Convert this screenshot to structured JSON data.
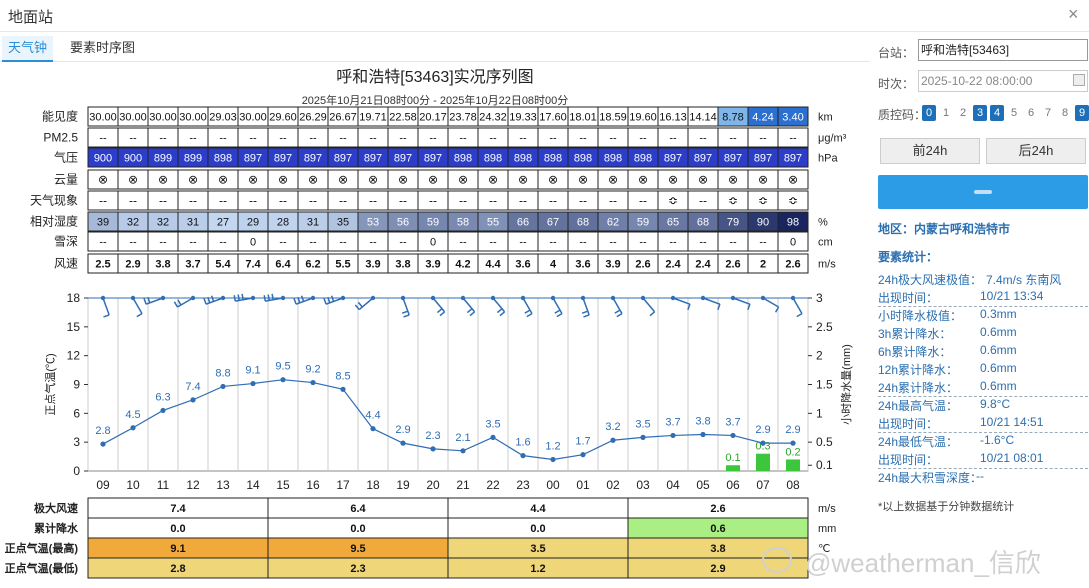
{
  "window": {
    "title": "地面站",
    "close": "×"
  },
  "tabs": [
    {
      "label": "天气钟",
      "active": true
    },
    {
      "label": "要素时序图",
      "active": false
    }
  ],
  "chart": {
    "title": "呼和浩特[53463]实况序列图",
    "subtitle": "2025年10月21日08时00分 - 2025年10月22日08时00分",
    "hours": [
      "09",
      "10",
      "11",
      "12",
      "13",
      "14",
      "15",
      "16",
      "17",
      "18",
      "19",
      "20",
      "21",
      "22",
      "23",
      "00",
      "01",
      "02",
      "03",
      "04",
      "05",
      "06",
      "07",
      "08"
    ],
    "rows": [
      {
        "label": "能见度",
        "unit": "km",
        "values": [
          "30.00",
          "30.00",
          "30.00",
          "30.00",
          "29.03",
          "30.00",
          "29.60",
          "26.29",
          "26.67",
          "19.71",
          "22.58",
          "20.17",
          "23.78",
          "24.32",
          "19.33",
          "17.60",
          "18.01",
          "18.59",
          "19.60",
          "16.13",
          "14.14",
          "8.78",
          "4.24",
          "3.40"
        ]
      },
      {
        "label": "PM2.5",
        "unit": "μg/m³",
        "values": [
          "--",
          "--",
          "--",
          "--",
          "--",
          "--",
          "--",
          "--",
          "--",
          "--",
          "--",
          "--",
          "--",
          "--",
          "--",
          "--",
          "--",
          "--",
          "--",
          "--",
          "--",
          "--",
          "--",
          "--"
        ]
      },
      {
        "label": "气压",
        "unit": "hPa",
        "values": [
          "900",
          "900",
          "899",
          "899",
          "898",
          "897",
          "897",
          "897",
          "897",
          "897",
          "897",
          "897",
          "898",
          "898",
          "898",
          "898",
          "898",
          "898",
          "898",
          "897",
          "897",
          "897",
          "897",
          "897"
        ]
      },
      {
        "label": "云量",
        "unit": "",
        "values": [
          "⊗",
          "⊗",
          "⊗",
          "⊗",
          "⊗",
          "⊗",
          "⊗",
          "⊗",
          "⊗",
          "⊗",
          "⊗",
          "⊗",
          "⊗",
          "⊗",
          "⊗",
          "⊗",
          "⊗",
          "⊗",
          "⊗",
          "⊗",
          "⊗",
          "⊗",
          "⊗",
          "⊗"
        ]
      },
      {
        "label": "天气现象",
        "unit": "",
        "values": [
          "--",
          "--",
          "--",
          "--",
          "--",
          "--",
          "--",
          "--",
          "--",
          "--",
          "--",
          "--",
          "--",
          "--",
          "--",
          "--",
          "--",
          "--",
          "--",
          "≎",
          "--",
          "≎",
          "≎",
          "≎"
        ]
      },
      {
        "label": "相对湿度",
        "unit": "%",
        "values": [
          "39",
          "32",
          "32",
          "31",
          "27",
          "29",
          "28",
          "31",
          "35",
          "53",
          "56",
          "59",
          "58",
          "55",
          "66",
          "67",
          "68",
          "62",
          "59",
          "65",
          "68",
          "79",
          "90",
          "98"
        ]
      },
      {
        "label": "雪深",
        "unit": "cm",
        "values": [
          "--",
          "--",
          "--",
          "--",
          "--",
          "0",
          "--",
          "--",
          "--",
          "--",
          "--",
          "0",
          "--",
          "--",
          "--",
          "--",
          "--",
          "--",
          "--",
          "--",
          "--",
          "--",
          "--",
          "0"
        ]
      },
      {
        "label": "风速",
        "unit": "m/s",
        "values": [
          "2.5",
          "2.9",
          "3.8",
          "3.7",
          "5.4",
          "7.4",
          "6.4",
          "6.2",
          "5.5",
          "3.9",
          "3.8",
          "3.9",
          "4.2",
          "4.4",
          "3.6",
          "4",
          "3.6",
          "3.9",
          "2.6",
          "2.4",
          "2.4",
          "2.6",
          "2",
          "2.6"
        ]
      }
    ],
    "colors": {
      "vis_high": "#ffffff",
      "vis_mid": "#7fb6ea",
      "vis_low": "#2b6fd0",
      "pressure": "#2c3ec9",
      "humidity_low": "#c8dcf5",
      "humidity_high": "#14205a",
      "line": "#2f6db5",
      "bar": "#3cc63c",
      "gust_bg": "#ffffff",
      "temp_high_a": "#f2a93b",
      "temp_low": "#efd679",
      "rain_bg": "#a9ef84"
    },
    "y_left_label": "正点气温(℃)",
    "y_right_label": "小时降水量(mm)",
    "y_left_ticks": [
      "0",
      "3",
      "6",
      "9",
      "12",
      "15",
      "18"
    ],
    "y_right_ticks": [
      "0.1",
      "0.5",
      "1",
      "1.5",
      "2",
      "2.5",
      "3"
    ],
    "summary": [
      {
        "label": "极大风速",
        "unit": "m/s",
        "values": [
          "7.4",
          "6.4",
          "4.4",
          "2.6"
        ]
      },
      {
        "label": "累计降水",
        "unit": "mm",
        "values": [
          "0.0",
          "0.0",
          "0.0",
          "0.6"
        ]
      },
      {
        "label": "正点气温(最高)",
        "unit": "℃",
        "values": [
          "9.1",
          "9.5",
          "3.5",
          "3.8"
        ]
      },
      {
        "label": "正点气温(最低)",
        "unit": "",
        "values": [
          "2.8",
          "2.3",
          "1.2",
          "2.9"
        ]
      }
    ]
  },
  "chart_data": {
    "type": "line",
    "x": [
      "09",
      "10",
      "11",
      "12",
      "13",
      "14",
      "15",
      "16",
      "17",
      "18",
      "19",
      "20",
      "21",
      "22",
      "23",
      "00",
      "01",
      "02",
      "03",
      "04",
      "05",
      "06",
      "07",
      "08"
    ],
    "series": [
      {
        "name": "正点气温(℃)",
        "values": [
          2.8,
          4.5,
          6.3,
          7.4,
          8.8,
          9.1,
          9.5,
          9.2,
          8.5,
          4.4,
          2.9,
          2.3,
          2.1,
          3.5,
          1.6,
          1.2,
          1.7,
          3.2,
          3.5,
          3.7,
          3.8,
          3.7,
          2.9,
          2.9
        ]
      },
      {
        "name": "小时降水量(mm)",
        "type": "bar",
        "values": [
          0,
          0,
          0,
          0,
          0,
          0,
          0,
          0,
          0,
          0,
          0,
          0,
          0,
          0,
          0,
          0,
          0,
          0,
          0,
          0,
          0,
          0.1,
          0.3,
          0.2
        ]
      }
    ],
    "ylim_left": [
      0,
      18
    ],
    "ylim_right": [
      0,
      3
    ]
  },
  "sidebar": {
    "station_label": "台站：",
    "station_value": "呼和浩特[53463]",
    "time_label": "时次：",
    "time_value": "2025-10-22 08:00:00",
    "qc_label": "质控码：",
    "qc_codes": [
      {
        "v": "0",
        "on": true
      },
      {
        "v": "1",
        "on": false
      },
      {
        "v": "2",
        "on": false
      },
      {
        "v": "3",
        "on": true
      },
      {
        "v": "4",
        "on": true
      },
      {
        "v": "5",
        "on": false
      },
      {
        "v": "6",
        "on": false
      },
      {
        "v": "7",
        "on": false
      },
      {
        "v": "8",
        "on": false
      },
      {
        "v": "9",
        "on": true
      }
    ],
    "prev": "前24h",
    "next": "后24h",
    "region": "地区：内蒙古呼和浩特市",
    "stats_title": "要素统计：",
    "stats": [
      {
        "k": "24h极大风速极值：",
        "v": "7.4m/s 东南风"
      },
      {
        "k": "出现时间：",
        "v": "10/21 13:34"
      },
      {
        "k": "小时降水极值：",
        "v": "0.3mm"
      },
      {
        "k": "3h累计降水：",
        "v": "0.6mm"
      },
      {
        "k": "6h累计降水：",
        "v": "0.6mm"
      },
      {
        "k": "12h累计降水：",
        "v": "0.6mm"
      },
      {
        "k": "24h累计降水：",
        "v": "0.6mm"
      },
      {
        "k": "24h最高气温：",
        "v": "9.8°C"
      },
      {
        "k": "出现时间：",
        "v": "10/21 14:51"
      },
      {
        "k": "24h最低气温：",
        "v": "-1.6°C"
      },
      {
        "k": "出现时间：",
        "v": "10/21 08:01"
      },
      {
        "k": "24h最大积雪深度：",
        "v": "--"
      }
    ],
    "footnote": "*以上数据基于分钟数据统计"
  },
  "watermark": "@weatherman_信欣"
}
